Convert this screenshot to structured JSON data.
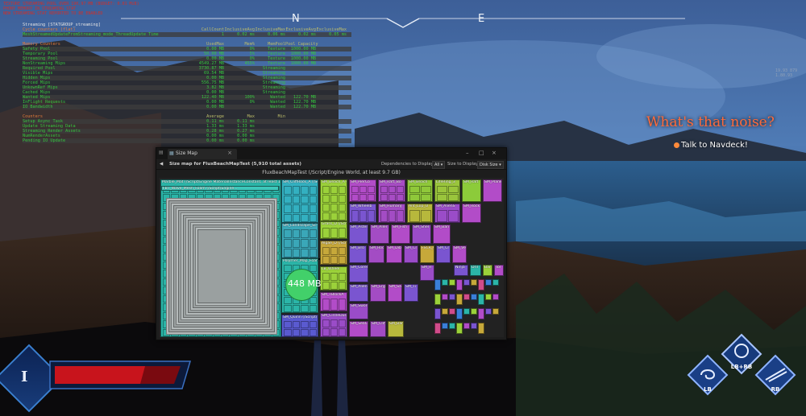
{
  "debug": {
    "lines": [
      "TEXTURE STREAMING POOL OVER 190,97 MB (BUDGET: 0.01 MiB)",
      "PHONY MEMORY IN STREAMING STAT",
      "NEW STREAMING STAT REPORTED TO BE ENABLED"
    ],
    "stat_group": "Streaming [STATGROUP_streaming]",
    "cycle_header": "Cycle counters (flat)",
    "cycle_cols": [
      "CallCount",
      "InclusiveAvg",
      "InclusiveMax",
      "ExclusiveAvg",
      "ExclusiveMax"
    ],
    "cycle_rows": [
      {
        "name": "MeshStreamedUpdateFromStreaming_mode_ThreadUpdate Time",
        "vals": [
          "1",
          "0.02 ms",
          "0.06 ms",
          "0.02 ms",
          "0.05 ms"
        ]
      }
    ],
    "memory_header": "Memory Counters",
    "memory_cols": [
      "UsedMax",
      "Mem%",
      "MemPool",
      "Pool Capacity"
    ],
    "memory_rows": [
      {
        "name": "Safety Pool",
        "vals": [
          "0.00 MB",
          "0%",
          "Texture",
          "1000.00 MB"
        ]
      },
      {
        "name": "Temporary Pool",
        "vals": [
          "50.00 MB",
          "5%",
          "Texture",
          "1000.00 MB"
        ]
      },
      {
        "name": "Streaming Pool",
        "vals": [
          "0.00 MB",
          "0%",
          "Texture",
          "1000.00 MB"
        ]
      },
      {
        "name": "NonStreaming Mips",
        "vals": [
          "4549.27 MB",
          "455%",
          "Texture",
          "1000.00 MB"
        ]
      },
      {
        "name": "Required Pool",
        "vals": [
          "3730.87 MB",
          "",
          "Streaming",
          ""
        ]
      },
      {
        "name": "Visible Mips",
        "vals": [
          "69.54 MB",
          "",
          "Streaming",
          ""
        ]
      },
      {
        "name": "Hidden Mips",
        "vals": [
          "0.00 MB",
          "",
          "Streaming",
          ""
        ]
      },
      {
        "name": "Forced Mips",
        "vals": [
          "556.75 MB",
          "",
          "Streaming",
          ""
        ]
      },
      {
        "name": "UnkownRef Mips",
        "vals": [
          "3.82 MB",
          "",
          "Streaming",
          ""
        ]
      },
      {
        "name": "Cached Mips",
        "vals": [
          "0.00 MB",
          "",
          "Streaming",
          ""
        ]
      },
      {
        "name": "Wanted Mips",
        "vals": [
          "122.40 MB",
          "100%",
          "Wanted",
          "122.70 MB"
        ]
      },
      {
        "name": "InFlight Requests",
        "vals": [
          "0.00 MB",
          "0%",
          "Wanted",
          "122.70 MB"
        ]
      },
      {
        "name": "IO Bandwidth",
        "vals": [
          "0.00 MB",
          "",
          "Wanted",
          "122.70 MB"
        ]
      }
    ],
    "counters_header": "Counters",
    "counters_cols": [
      "Average",
      "Max",
      "Min"
    ],
    "counters_rows": [
      {
        "name": "Setup Async Task",
        "vals": [
          "0.11 ms",
          "0.11 ms",
          ""
        ]
      },
      {
        "name": "Update Streaming Data",
        "vals": [
          "1.33 ms",
          "1.33 ms",
          ""
        ]
      },
      {
        "name": "Streaming Render Assets",
        "vals": [
          "0.28 ms",
          "0.27 ms",
          ""
        ]
      },
      {
        "name": "NumRenderAssets",
        "vals": [
          "0.00 ms",
          "0.00 ms",
          ""
        ]
      },
      {
        "name": "Pending IO Update",
        "vals": [
          "0.00 ms",
          "0.00 ms",
          ""
        ]
      }
    ]
  },
  "compass": {
    "north": "N",
    "east": "E"
  },
  "coords": [
    "19.93 879",
    "1.80.93"
  ],
  "quest": {
    "title": "What's that noise?",
    "objective": "Talk to Navdeck!"
  },
  "sizemap": {
    "tab_title": "Size Map",
    "heading": "Size map for FluxBeachMapTest  (5,910 total assets)",
    "deps_label": "Dependencies to Display",
    "deps_value": "All",
    "size_label": "Size to Display",
    "size_value": "Disk Size",
    "root_label": "FluxBeachMapTest  (/Script/Engine World, at least 9.7 GB)",
    "big_value": "448 MB",
    "tiles": [
      {
        "label": "Marble_Mat  (/Script/Engine MaterialInstanceConstant, at least 1.5 GB)"
      },
      {
        "label": "FBT_Wave_Mesh_Foam  (/Script/Engine..."
      },
      {
        "label": "SM_CliffRock_A  (/Script/..."
      },
      {
        "label": "SM_Landscape_Sc-le"
      },
      {
        "label": "SM_Beach_A  (/Scri..."
      },
      {
        "label": "Mesh_DSt"
      },
      {
        "label": "SM_PierCo"
      },
      {
        "label": "SM_Raft_Bo"
      },
      {
        "label": "SM_Beach"
      },
      {
        "label": "LifeRing_3"
      },
      {
        "label": "SM_Raft"
      },
      {
        "label": "SM_Plank"
      },
      {
        "label": "SM_Wheelb"
      },
      {
        "label": "SM_HumanJ"
      },
      {
        "label": "Ant_Lop_O"
      },
      {
        "label": "SM_AlienS"
      },
      {
        "label": "SM_Rock"
      },
      {
        "label": "Grass_D  (/Script..."
      },
      {
        "label": "Algae_D  (/Script..."
      },
      {
        "label": "SM_Aster"
      },
      {
        "label": "SM_Aller"
      },
      {
        "label": "SM_Fish"
      },
      {
        "label": "SM_Shel"
      },
      {
        "label": "SM_Ban"
      },
      {
        "label": "LB_Wheel"
      },
      {
        "label": "SM_Bro"
      },
      {
        "label": "SM_Roc"
      },
      {
        "label": "SM_Dib"
      },
      {
        "label": "SM_Cr"
      },
      {
        "label": "FSCR_Colide"
      },
      {
        "label": "SM_Cr"
      },
      {
        "label": "SM_Ve"
      },
      {
        "label": "Polymer_Map_Foam  (/Script/Engine MaterialInstance..."
      },
      {
        "label": "SM_TBlockA"
      },
      {
        "label": "SM_Corel"
      },
      {
        "label": "SM_CircleDust"
      },
      {
        "label": "SM_AlienD"
      },
      {
        "label": "SM_Erg"
      },
      {
        "label": "SM_Sal"
      },
      {
        "label": "SM_Ti"
      },
      {
        "label": "SM_Quinn  (/Script/Eng..."
      },
      {
        "label": "SM_SwordL_Trn"
      },
      {
        "label": "SM_SeaCo"
      },
      {
        "label": "SM_Cliff"
      },
      {
        "label": "SM_Bar"
      },
      {
        "label": "Ninja"
      },
      {
        "label": "Dril"
      },
      {
        "label": "Bar"
      },
      {
        "label": "Tor"
      },
      {
        "label": "SM_R"
      }
    ]
  },
  "hud": {
    "level": "I",
    "skills": [
      "LB",
      "LB+RB",
      "RB"
    ]
  }
}
